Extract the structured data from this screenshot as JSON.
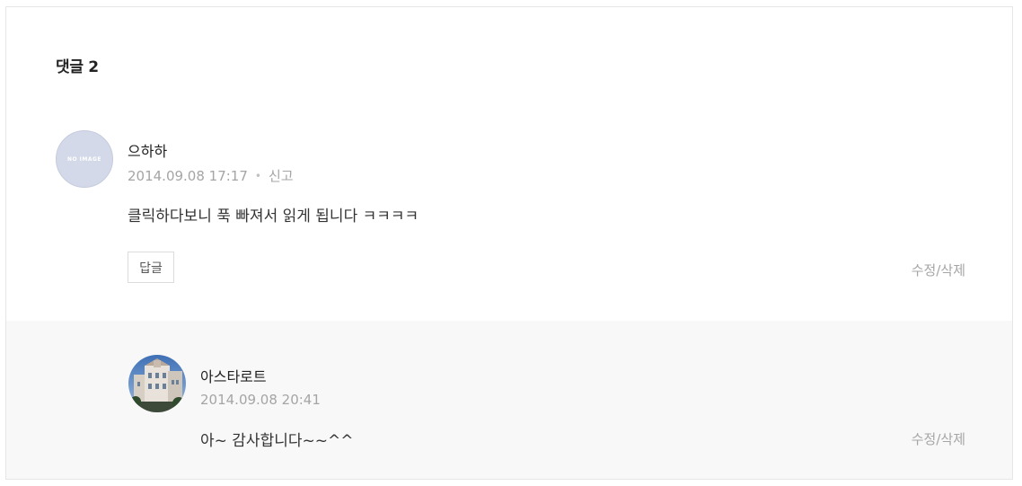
{
  "comments_header": {
    "label": "댓글 2"
  },
  "comments": [
    {
      "author": "으하하",
      "avatar_text": "NO IMAGE",
      "timestamp": "2014.09.08 17:17",
      "report_label": "신고",
      "separator": "•",
      "text": "클릭하다보니 푹 빠져서 읽게 됩니다 ㅋㅋㅋㅋ",
      "reply_button": "답글",
      "edit_delete": "수정/삭제"
    }
  ],
  "replies": [
    {
      "author": "아스타로트",
      "avatar": "building-photo",
      "timestamp": "2014.09.08 20:41",
      "text": "아~ 감사합니다~~^^",
      "edit_delete": "수정/삭제"
    }
  ],
  "colors": {
    "reply_background": "#f8f8f8",
    "meta_text": "#a5a5a5",
    "avatar_placeholder": "#d3d9e8"
  }
}
